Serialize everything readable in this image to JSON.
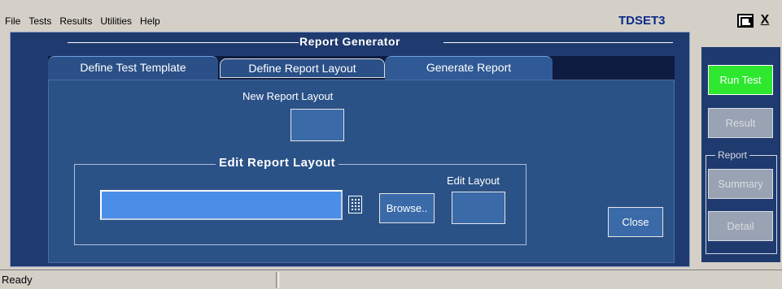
{
  "menu": {
    "items": [
      {
        "label": "File"
      },
      {
        "label": "Tests"
      },
      {
        "label": "Results"
      },
      {
        "label": "Utilities"
      },
      {
        "label": "Help"
      }
    ],
    "app_name": "TDSET3",
    "close_label": "X"
  },
  "panel": {
    "title": "Report Generator",
    "tabs": [
      {
        "label": "Define Test Template"
      },
      {
        "label": "Define Report Layout"
      },
      {
        "label": "Generate Report"
      }
    ],
    "new_report_layout_label": "New Report Layout",
    "edit_group_title": "Edit Report Layout",
    "edit_layout_label": "Edit Layout",
    "path_value": "",
    "browse_label": "Browse..",
    "close_label": "Close"
  },
  "side": {
    "run_test_label": "Run Test",
    "result_label": "Result",
    "report_group_title": "Report",
    "summary_label": "Summary",
    "detail_label": "Detail"
  },
  "status": {
    "left": "Ready",
    "right": ""
  },
  "colors": {
    "panel_bg": "#1f3a6e",
    "content_bg": "#2b5287",
    "run_button": "#2ee830",
    "brand_title": "#0b2a88"
  }
}
